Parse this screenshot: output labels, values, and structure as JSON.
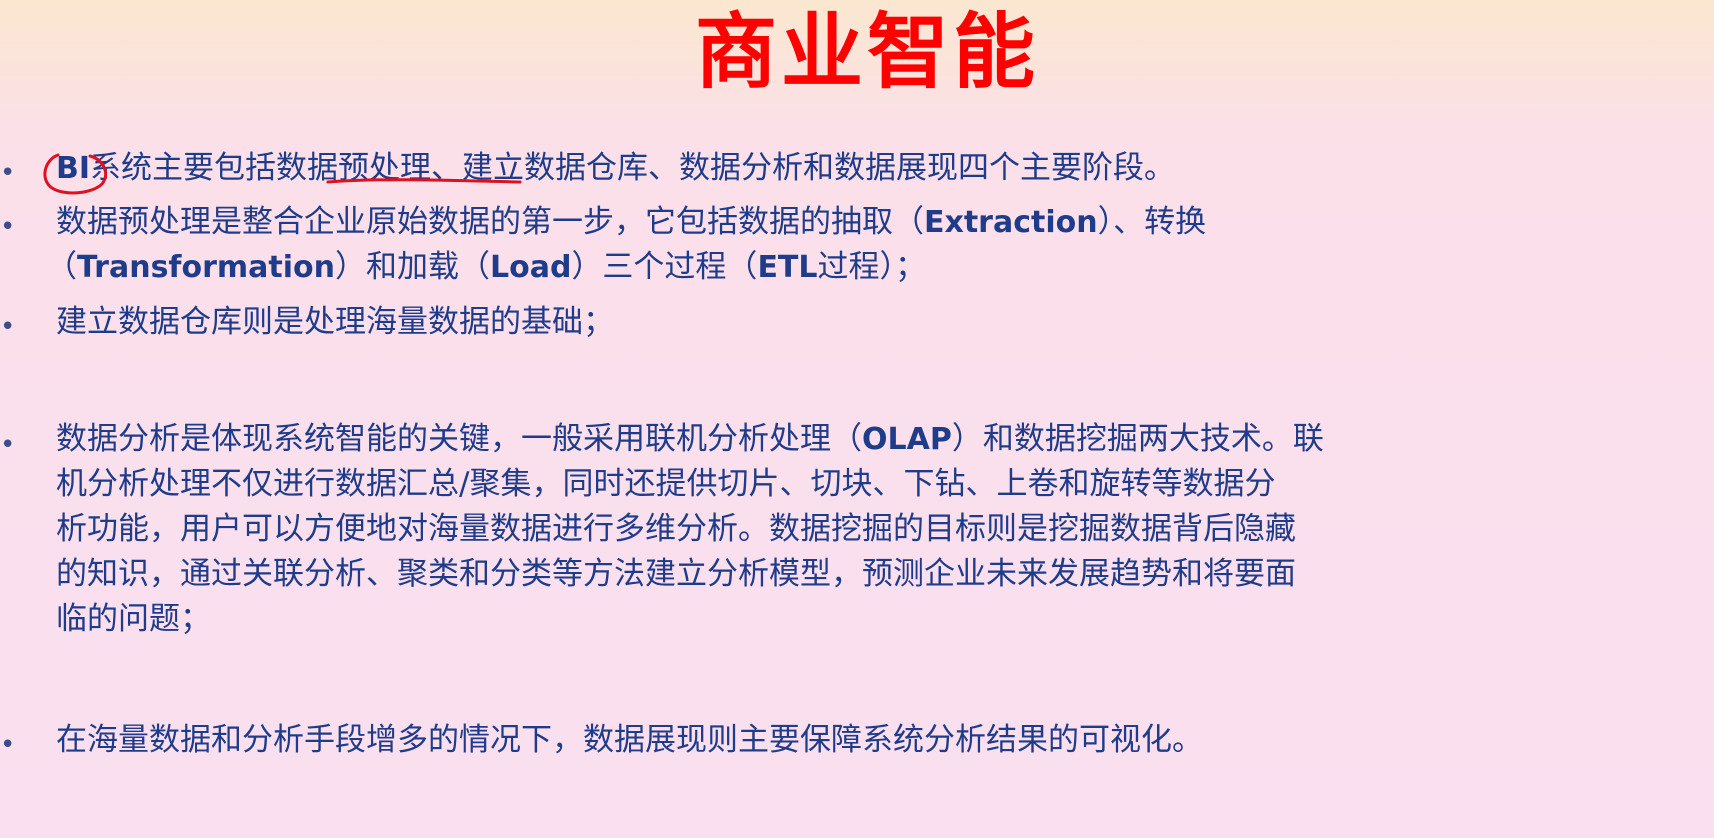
{
  "slide": {
    "title": "商业智能",
    "paragraphs": [
      {
        "lines": [
          [
            "BI",
            "系统主要包括",
            "数据预处理",
            "、建立数据仓库、数据分析和数据展现四个主要阶段。"
          ]
        ]
      },
      {
        "lines": [
          "数据预处理是整合企业原始数据的第一步，它包括数据的抽取（Extraction）、转换",
          "（Transformation）和加载（Load）三个过程（ETL过程）；"
        ]
      },
      {
        "lines": [
          "建立数据仓库则是处理海量数据的基础；"
        ]
      },
      {
        "lines": [
          "数据分析是体现系统智能的关键，一般采用联机分析处理（OLAP）和数据挖掘两大技术。联",
          "机分析处理不仅进行数据汇总/聚集，同时还提供切片、切块、下钻、上卷和旋转等数据分",
          "析功能，用户可以方便地对海量数据进行多维分析。数据挖掘的目标则是挖掘数据背后隐藏",
          "的知识，通过关联分析、聚类和分类等方法建立分析模型，预测企业未来发展趋势和将要面",
          "临的问题；"
        ]
      },
      {
        "lines": [
          "在海量数据和分析手段增多的情况下，数据展现则主要保障系统分析结果的可视化。"
        ]
      }
    ]
  },
  "colors": {
    "title": "#ff0000",
    "body_text": "#1f3c8a",
    "annotation": "#e01020"
  }
}
